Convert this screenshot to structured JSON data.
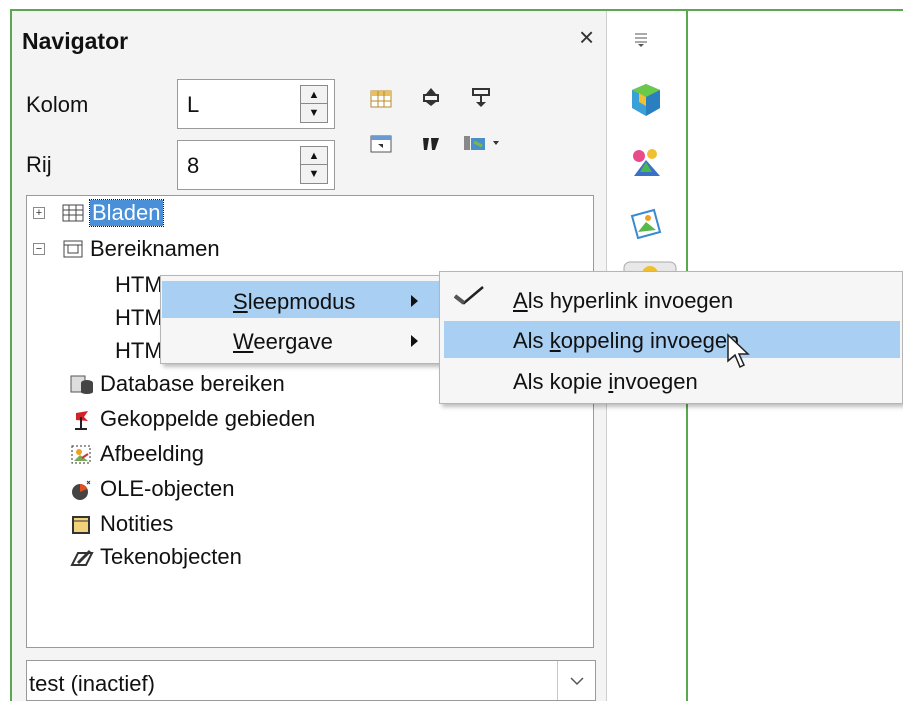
{
  "navigator": {
    "title": "Navigator",
    "close": "×",
    "kolom_label": "Kolom",
    "kolom_value": "L",
    "rij_label": "Rij",
    "rij_value": "8"
  },
  "tree": {
    "items": [
      {
        "label": "Bladen",
        "icon": "sheet-icon"
      },
      {
        "label": "Bereiknamen",
        "icon": "range-names-icon"
      },
      {
        "label": "HTM",
        "icon": ""
      },
      {
        "label": "HTM",
        "icon": ""
      },
      {
        "label": "HTM",
        "icon": ""
      },
      {
        "label": "Database bereiken",
        "icon": "database-icon"
      },
      {
        "label": "Gekoppelde gebieden",
        "icon": "flag-icon"
      },
      {
        "label": "Afbeelding",
        "icon": "image-icon"
      },
      {
        "label": "OLE-objecten",
        "icon": "ole-icon"
      },
      {
        "label": "Notities",
        "icon": "note-icon"
      },
      {
        "label": "Tekenobjecten",
        "icon": "drawing-icon"
      }
    ]
  },
  "combo": {
    "value": "test (inactief)"
  },
  "context_menu": {
    "items": [
      {
        "prefix": "",
        "ul": "S",
        "rest": "leepmodus"
      },
      {
        "prefix": "",
        "ul": "W",
        "rest": "eergave"
      }
    ]
  },
  "submenu": {
    "items": [
      {
        "prefix": "",
        "ul": "A",
        "rest": "ls hyperlink invoegen",
        "checked": true
      },
      {
        "prefix": "Als ",
        "ul": "k",
        "rest": "oppeling invoegen",
        "checked": false
      },
      {
        "prefix": "Als kopie ",
        "ul": "i",
        "rest": "nvoegen",
        "checked": false
      }
    ]
  },
  "colors": {
    "frame": "#5aa84f",
    "selection": "#4a90d9",
    "menu_highlight": "#a9cff3"
  }
}
